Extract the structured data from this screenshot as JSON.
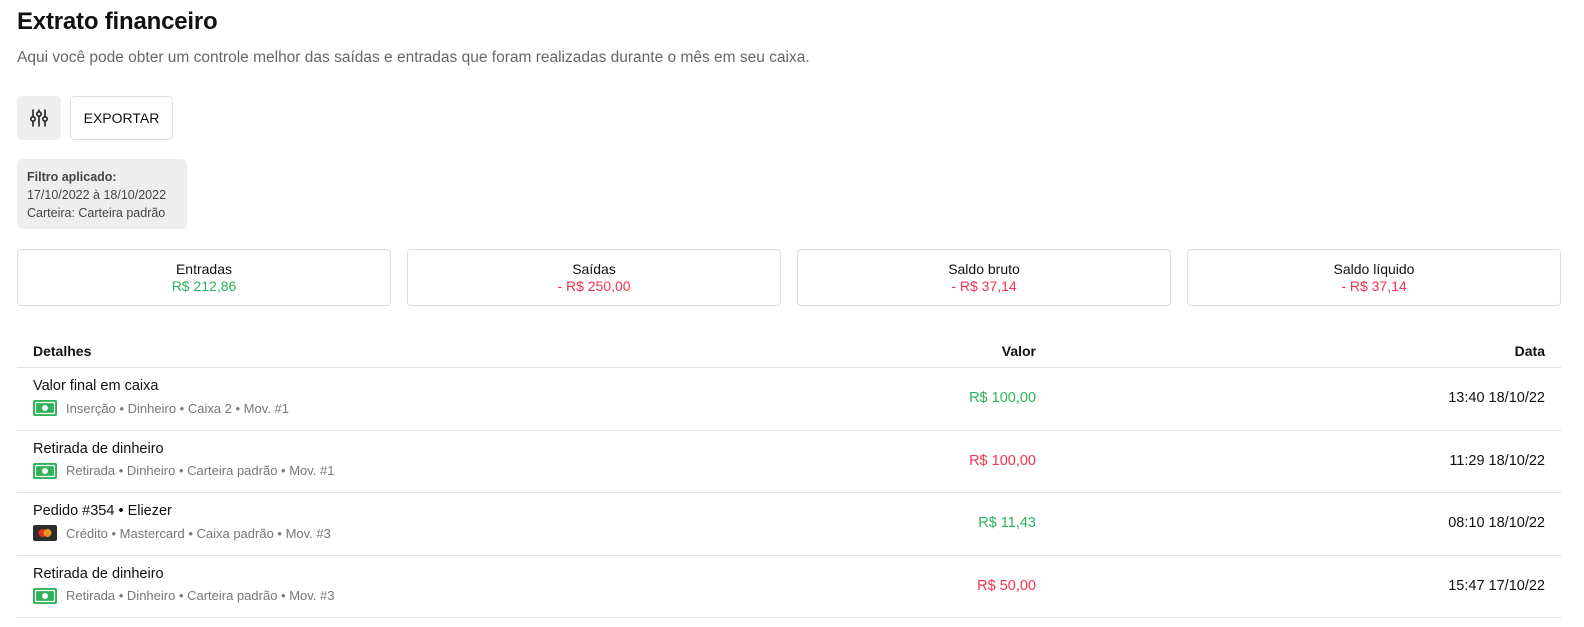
{
  "header": {
    "title": "Extrato financeiro",
    "subtitle": "Aqui você pode obter um controle melhor das saídas e entradas que foram realizadas durante o mês em seu caixa."
  },
  "toolbar": {
    "filter_icon": "sliders-icon",
    "export_label": "EXPORTAR"
  },
  "filter": {
    "title": "Filtro aplicado:",
    "date_range": "17/10/2022 à 18/10/2022",
    "wallet": "Carteira: Carteira padrão"
  },
  "summary": [
    {
      "label": "Entradas",
      "value": "R$ 212,86",
      "tone": "positive"
    },
    {
      "label": "Saídas",
      "value": "- R$ 250,00",
      "tone": "negative"
    },
    {
      "label": "Saldo bruto",
      "value": "- R$ 37,14",
      "tone": "negative"
    },
    {
      "label": "Saldo líquido",
      "value": "- R$ 37,14",
      "tone": "negative"
    }
  ],
  "table": {
    "columns": {
      "details": "Detalhes",
      "value": "Valor",
      "date": "Data"
    },
    "rows": [
      {
        "title": "Valor final em caixa",
        "icon": "cash-icon",
        "meta": "Inserção • Dinheiro • Caixa 2 • Mov. #1",
        "value": "R$ 100,00",
        "tone": "positive",
        "date": "13:40 18/10/22"
      },
      {
        "title": "Retirada de dinheiro",
        "icon": "cash-icon",
        "meta": "Retirada • Dinheiro • Carteira padrão • Mov. #1",
        "value": "R$ 100,00",
        "tone": "negative",
        "date": "11:29 18/10/22"
      },
      {
        "title": "Pedido #354 • Eliezer",
        "icon": "mastercard-icon",
        "meta": "Crédito • Mastercard • Caixa padrão • Mov. #3",
        "value": "R$ 11,43",
        "tone": "positive",
        "date": "08:10 18/10/22"
      },
      {
        "title": "Retirada de dinheiro",
        "icon": "cash-icon",
        "meta": "Retirada • Dinheiro • Carteira padrão • Mov. #3",
        "value": "R$ 50,00",
        "tone": "negative",
        "date": "15:47 17/10/22"
      }
    ]
  },
  "colors": {
    "positive": "#2bb35d",
    "negative": "#f0334e",
    "cash_icon": "#2fb25a",
    "card_icon_bg": "#2d2d2d"
  }
}
